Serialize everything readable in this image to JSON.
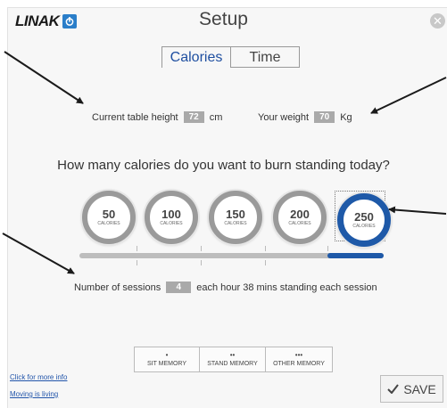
{
  "header": {
    "logo_text": "LINAK",
    "title": "Setup",
    "close_icon": "close-icon"
  },
  "tabs": [
    {
      "label": "Calories",
      "active": true
    },
    {
      "label": "Time",
      "active": false
    }
  ],
  "params": {
    "table_height_label": "Current table height",
    "table_height_value": "72",
    "table_height_unit": "cm",
    "weight_label": "Your weight",
    "weight_value": "70",
    "weight_unit": "Kg"
  },
  "question": "How many calories do you want to burn standing today?",
  "calorie_options": [
    {
      "value": "50",
      "label": "CALORIES",
      "selected": false
    },
    {
      "value": "100",
      "label": "CALORIES",
      "selected": false
    },
    {
      "value": "150",
      "label": "CALORIES",
      "selected": false
    },
    {
      "value": "200",
      "label": "CALORIES",
      "selected": false
    },
    {
      "value": "250",
      "label": "CALORIES",
      "selected": true
    }
  ],
  "slider": {
    "selected_fraction": 0.8
  },
  "sessions": {
    "prefix": "Number of sessions",
    "count": "4",
    "suffix": "each hour  38 mins standing each session"
  },
  "memory_buttons": [
    {
      "dots": "•",
      "label": "SIT MEMORY"
    },
    {
      "dots": "••",
      "label": "STAND MEMORY"
    },
    {
      "dots": "•••",
      "label": "OTHER MEMORY"
    }
  ],
  "links": {
    "more_info": "Click for more info",
    "moving": "Moving is living"
  },
  "save": {
    "label": "SAVE",
    "icon": "checkmark-icon"
  },
  "colors": {
    "accent": "#1e59a8",
    "circle_grey": "#9a9a9a",
    "value_box": "#a9a9a9"
  }
}
